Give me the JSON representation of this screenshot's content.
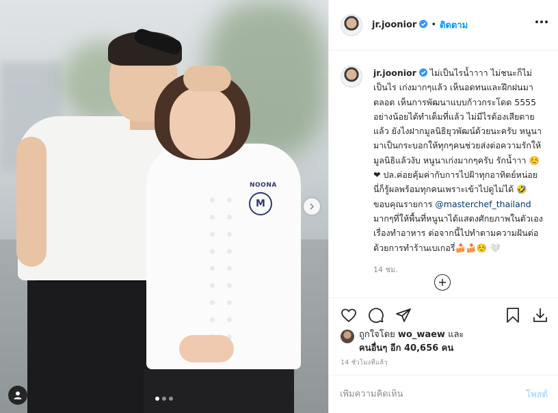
{
  "post": {
    "username": "jr.joonior",
    "separator": "•",
    "follow_label": "ติดตาม",
    "caption_username": "jr.joonior",
    "caption_before_mention": "ไม่เป็นไรน้ำาาา ไม่ชนะก็ไม่เป็นไร เก่งมากๆแล้ว เห็นอดทนและฝึกฝนมาตลอด เห็นการพัฒนาแบบก้าวกระโดด 5555 อย่างน้อยได้ทำเต็มที่แล้ว ไม่มีไรต้องเสียดายแล้ว ยังไงฝากมูลนิธิยุวพัฒน์ด้วยนะครับ หนูนามาเป็นกระบอกให้ทุกๆคนช่วยส่งต่อความรักให้มูลนิธิแล้วงับ หนูนาเก่งมากๆครับ รักน้ำาา ☺️ ❤ ปล.ค่อยคุ้มค่ากับการไปฝ้าทุกอาทิตย์หน่อย นี่ก็รู้ผลพร้อมทุกคนเพราะเข้าไปดูไม่ได้ 🤣\nขอบคุณรายการ ",
    "mention": "@masterchef_thailand",
    "caption_after_mention": "\nมากๆที่ให้พื้นที่หนูนาได้แสดงศักยภาพในตัวเองเรื่องทำอาหาร ต่อจากนี้ไปทำตามความฝันต่อด้วยการทำร้านเบเกอรี่🍰🍰☺️ 🤍",
    "caption_time": "14 ชม.",
    "liked_by_prefix": "ถูกใจโดย ",
    "liked_by_user": "wo_waew",
    "liked_by_and": " และ",
    "liked_by_others": "คนอื่นๆ อีก 40,656 คน",
    "timestamp": "14 ชั่วโมงที่แล้ว",
    "comment_placeholder": "เพิ่มความคิดเห็น",
    "post_label": "โพสต์",
    "coat_label": "NOONA",
    "coat_logo": "M"
  },
  "icons": {
    "verified": "verified-badge-icon",
    "more": "more-options-icon",
    "like": "heart-icon",
    "comment": "speech-bubble-icon",
    "share": "paper-plane-icon",
    "save": "bookmark-icon",
    "download": "download-icon",
    "load_more": "plus-circle-icon",
    "next": "chevron-right-icon",
    "tag": "user-tag-icon"
  },
  "carousel": {
    "count": 3,
    "active": 1
  },
  "colors": {
    "accent": "#0095f6",
    "post_disabled": "#b2dffc",
    "mention": "#00376b",
    "muted": "#8e8e8e"
  }
}
